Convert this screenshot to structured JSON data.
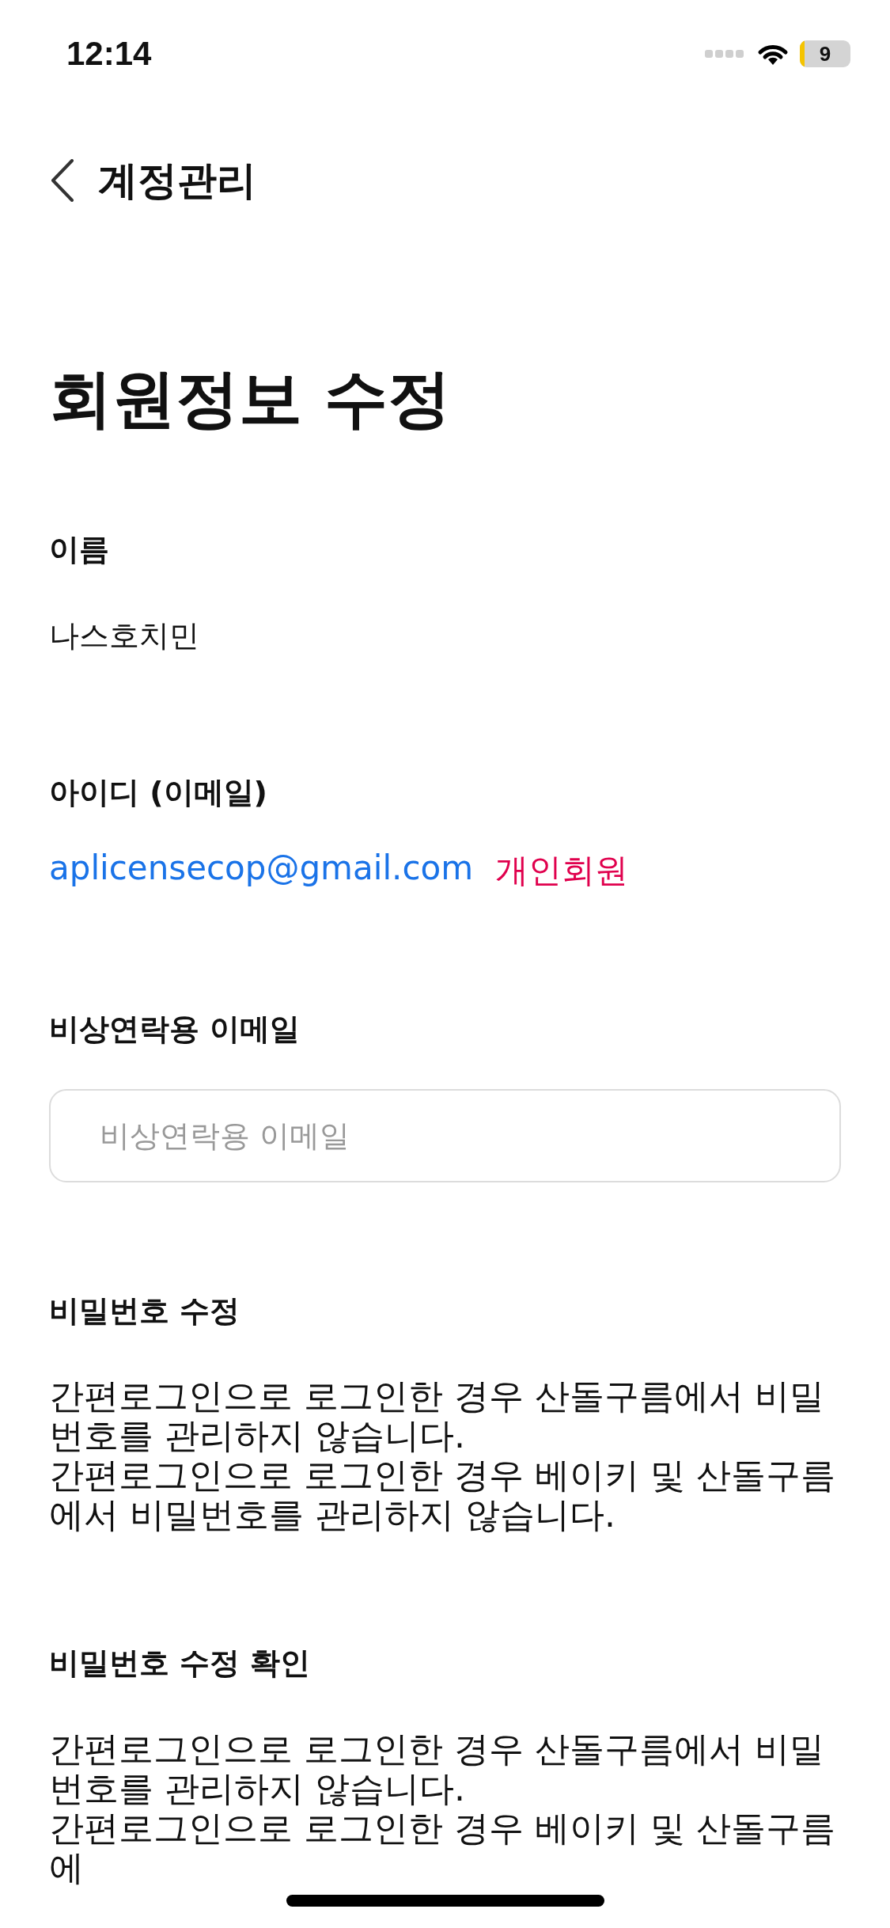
{
  "status_bar": {
    "time": "12:14",
    "battery": "9"
  },
  "nav": {
    "title": "계정관리"
  },
  "page_title": "회원정보 수정",
  "sections": [
    {
      "kind": "text",
      "label": "이름",
      "value": "나스호치민"
    },
    {
      "kind": "account",
      "label": "아이디 (이메일)",
      "value": "aplicensecop@gmail.com",
      "badge": "개인회원"
    },
    {
      "kind": "input",
      "label": "비상연락용 이메일",
      "placeholder": "비상연락용 이메일"
    },
    {
      "kind": "note",
      "label": "비밀번호 수정",
      "lines": [
        "간편로그인으로 로그인한 경우 산돌구름에서 비밀번호를 관리하지 않습니다.",
        "간편로그인으로 로그인한 경우 베이키 및 산돌구름에서 비밀번호를 관리하지 않습니다."
      ]
    },
    {
      "kind": "note",
      "label": "비밀번호 수정 확인",
      "lines": [
        "간편로그인으로 로그인한 경우 산돌구름에서 비밀번호를 관리하지 않습니다.",
        "간편로그인으로 로그인한 경우 베이키 및 산돌구름에"
      ]
    }
  ]
}
